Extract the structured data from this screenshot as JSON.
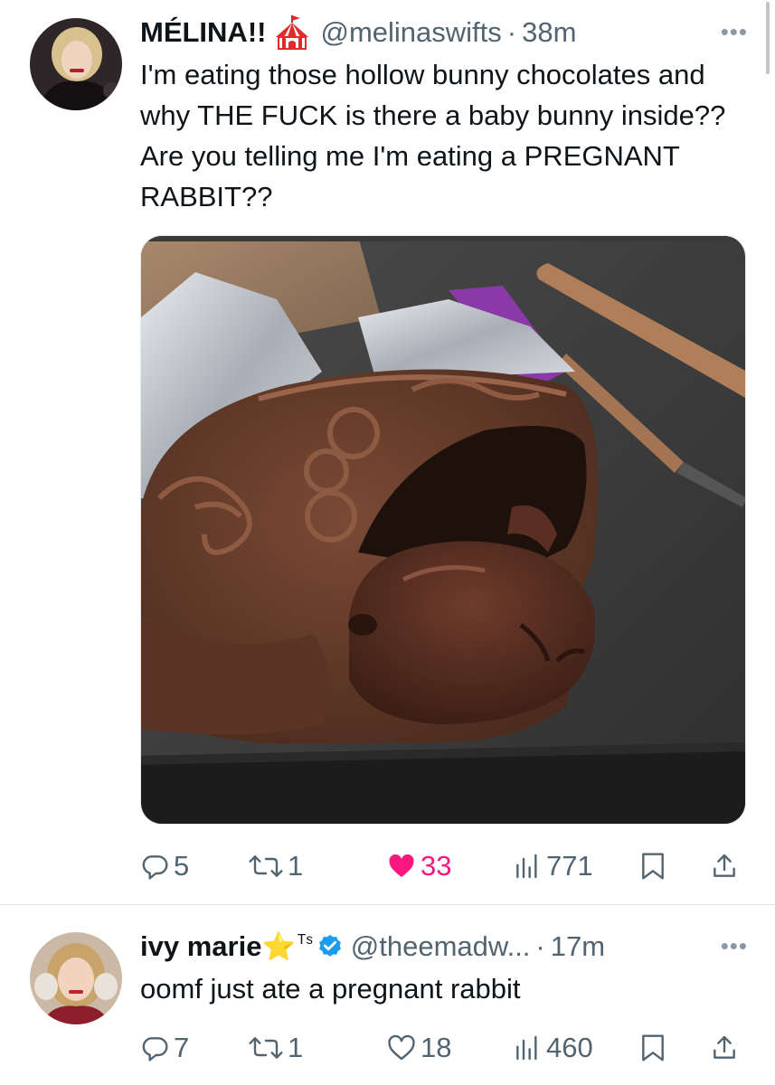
{
  "tweets": [
    {
      "name": "MÉLINA!!",
      "handle": "@melinaswifts",
      "separator": "·",
      "time": "38m",
      "text": "I'm eating those hollow bunny chocolates and why THE FUCK is there a baby bunny inside?? Are you telling me I'm eating a PREGNANT RABBIT??",
      "replies": "5",
      "retweets": "1",
      "likes": "33",
      "views": "771",
      "liked": true
    },
    {
      "name": "ivy marie",
      "name_emoji": "⭐",
      "name_suffix": "ᵀˢ",
      "verified": true,
      "handle": "@theemadw...",
      "separator": "·",
      "time": "17m",
      "text": "oomf just ate a pregnant rabbit",
      "replies": "7",
      "retweets": "1",
      "likes": "18",
      "views": "460",
      "liked": false
    }
  ],
  "colors": {
    "text": "#0f1419",
    "secondary": "#536471",
    "like_active": "#f91880",
    "verified": "#1d9bf0",
    "divider": "#e1e6ea"
  },
  "icons": [
    "circus-tent-icon",
    "more-icon",
    "reply-icon",
    "retweet-icon",
    "heart-icon",
    "views-icon",
    "bookmark-icon",
    "share-icon",
    "verified-badge-icon"
  ]
}
